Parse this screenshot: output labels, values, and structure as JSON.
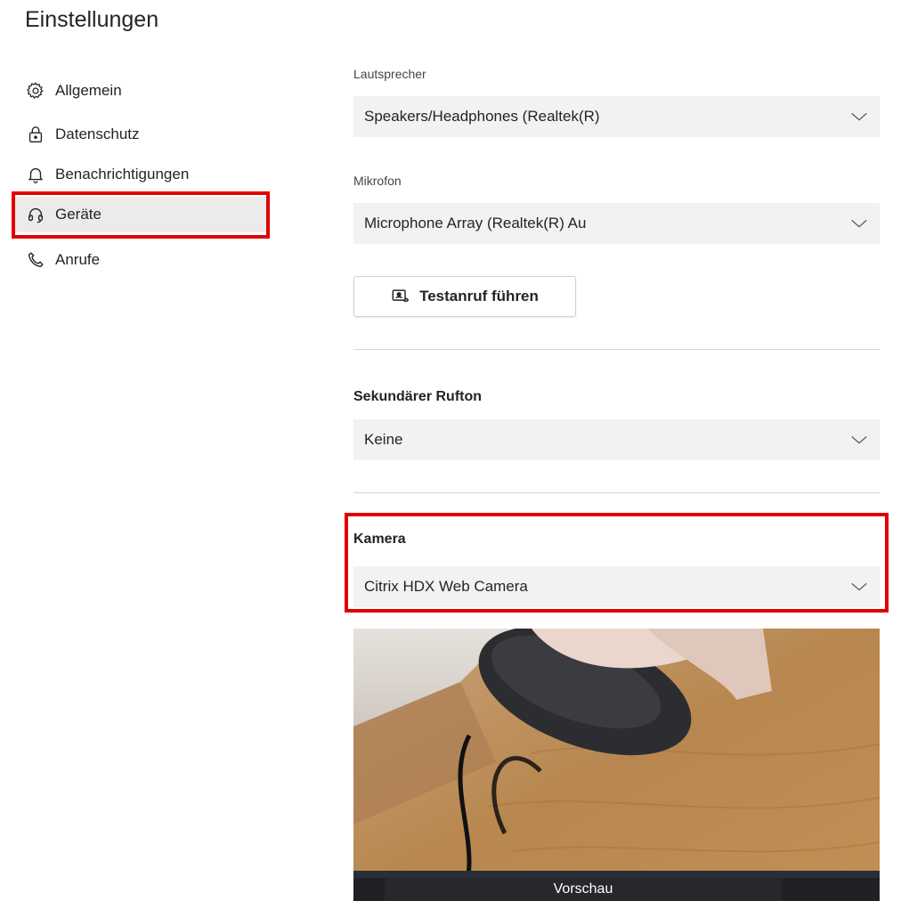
{
  "header": {
    "title": "Einstellungen"
  },
  "sidebar": {
    "items": [
      {
        "label": "Allgemein",
        "icon": "gear-icon"
      },
      {
        "label": "Datenschutz",
        "icon": "lock-icon"
      },
      {
        "label": "Benachrichtigungen",
        "icon": "bell-icon"
      },
      {
        "label": "Geräte",
        "icon": "headset-icon",
        "active": true
      },
      {
        "label": "Anrufe",
        "icon": "phone-icon"
      }
    ]
  },
  "devices": {
    "speaker": {
      "label": "Lautsprecher",
      "value": "Speakers/Headphones (Realtek(R)"
    },
    "microphone": {
      "label": "Mikrofon",
      "value": "Microphone Array (Realtek(R) Au"
    },
    "test_call_button": {
      "label": "Testanruf führen",
      "icon": "test-call-icon"
    },
    "secondary_ringer": {
      "title": "Sekundärer Rufton",
      "value": "Keine"
    },
    "camera": {
      "title": "Kamera",
      "value": "Citrix HDX Web Camera"
    },
    "preview": {
      "label": "Vorschau"
    }
  },
  "colors": {
    "highlight": "#e10000",
    "select_bg": "#f3f2f1",
    "active_nav_bg": "#ecebe9"
  }
}
